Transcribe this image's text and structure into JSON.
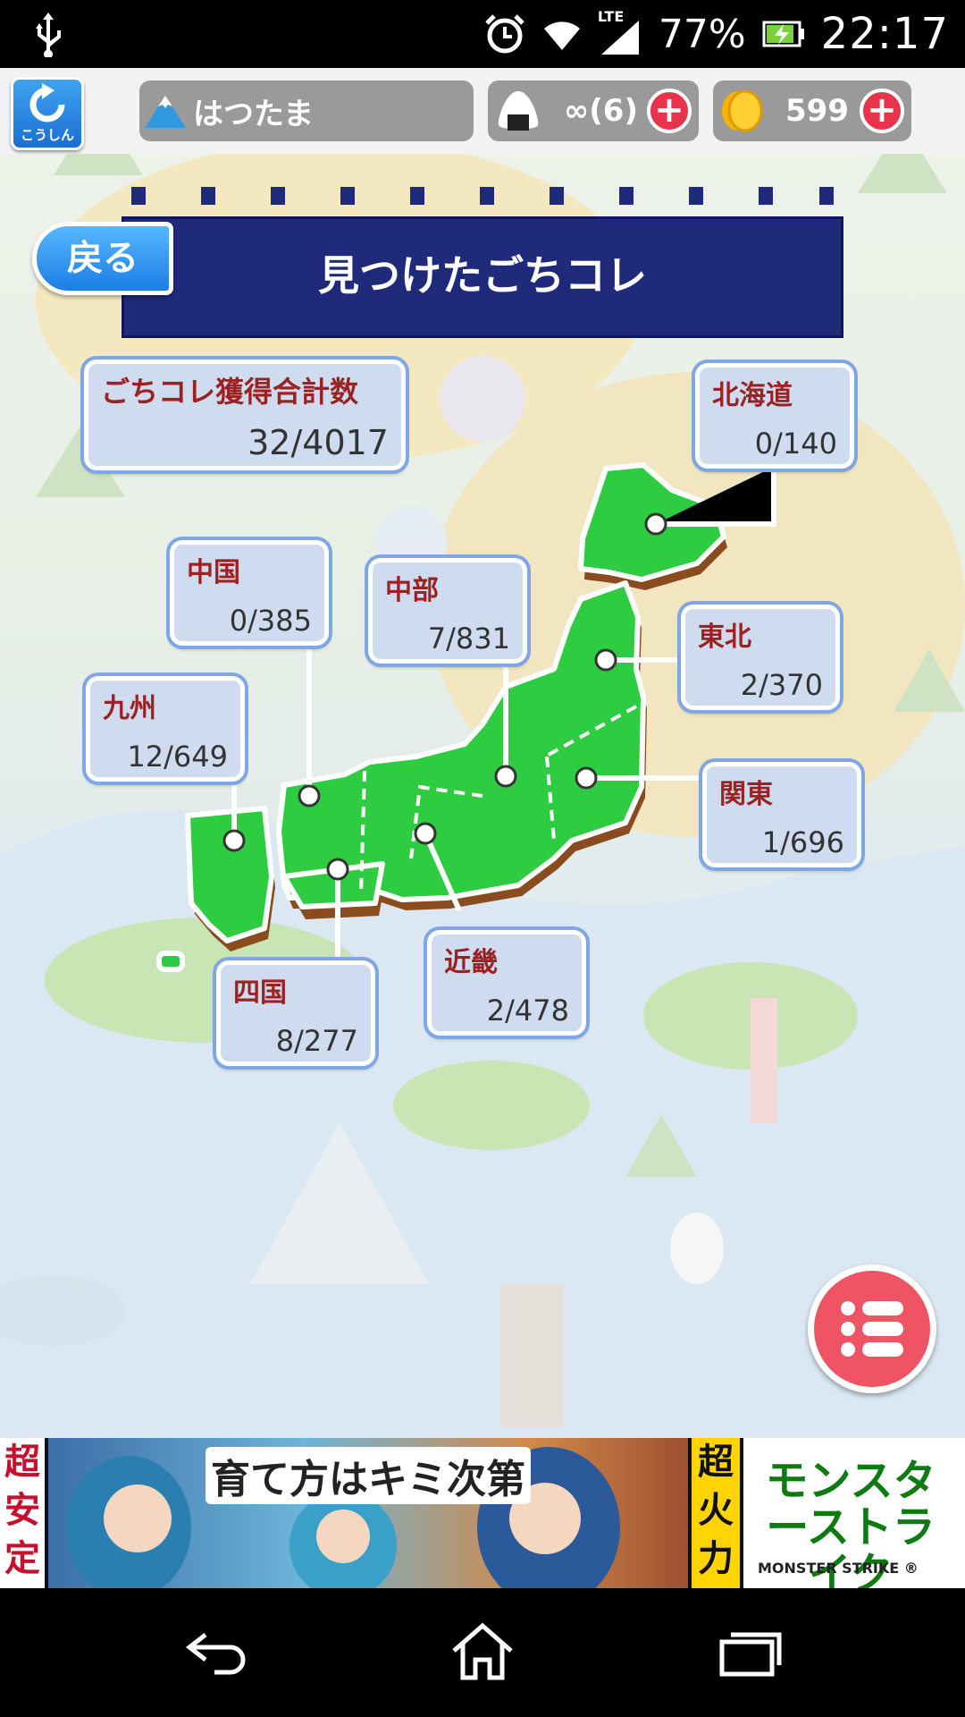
{
  "status_bar": {
    "network": "LTE",
    "battery": "77%",
    "time": "22:17"
  },
  "header": {
    "refresh_label": "こうしん",
    "player_name": "はつたま",
    "stamina": "∞(6)",
    "coins": "599"
  },
  "page": {
    "back_label": "戻る",
    "title": "見つけたごちコレ"
  },
  "total": {
    "label": "ごちコレ獲得合計数",
    "count": "32/4017"
  },
  "regions": [
    {
      "name": "北海道",
      "count": "0/140"
    },
    {
      "name": "東北",
      "count": "2/370"
    },
    {
      "name": "関東",
      "count": "1/696"
    },
    {
      "name": "中部",
      "count": "7/831"
    },
    {
      "name": "近畿",
      "count": "2/478"
    },
    {
      "name": "中国",
      "count": "0/385"
    },
    {
      "name": "四国",
      "count": "8/277"
    },
    {
      "name": "九州",
      "count": "12/649"
    }
  ],
  "ad": {
    "left_text": "超安定",
    "headline": "育て方はキミ次第",
    "right_text": "超火力",
    "logo": "モンスターストライク",
    "logo_en": "MONSTER STRIKE ®"
  },
  "colors": {
    "map_green": "#2ecc40",
    "banner_navy": "#1f2a7a",
    "card_fill": "#cfdcf0",
    "card_text": "#9c2222",
    "menu_button": "#ef5464"
  }
}
